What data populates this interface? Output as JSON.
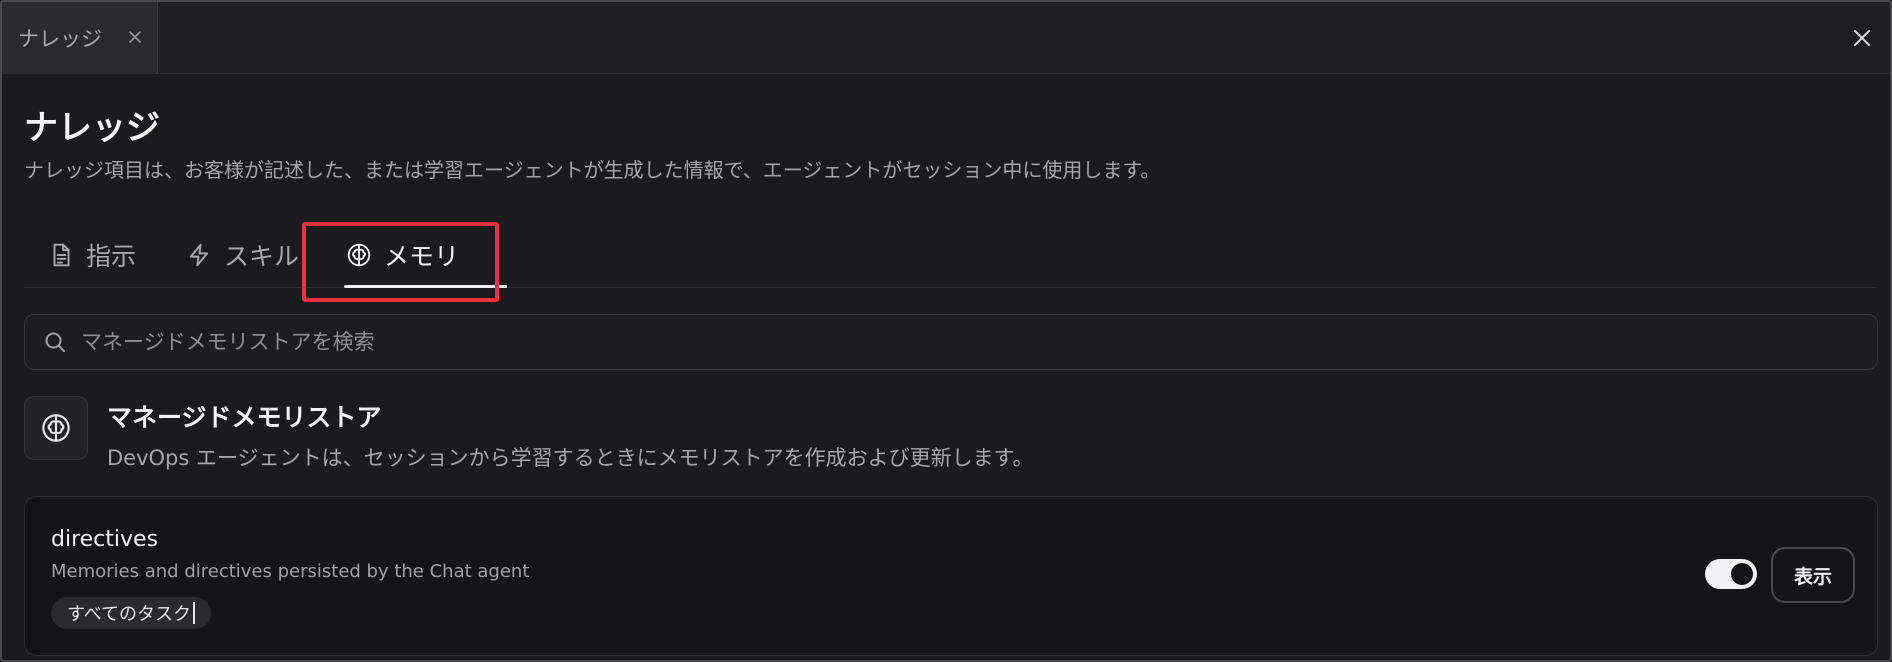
{
  "tab_strip": {
    "tab_label": "ナレッジ"
  },
  "header": {
    "title": "ナレッジ",
    "description": "ナレッジ項目は、お客様が記述した、または学習エージェントが生成した情報で、エージェントがセッション中に使用します。"
  },
  "tabs": [
    {
      "label": "指示",
      "icon": "document-icon"
    },
    {
      "label": "スキル",
      "icon": "lightning-icon"
    },
    {
      "label": "メモリ",
      "icon": "brain-icon",
      "active": true
    }
  ],
  "search": {
    "placeholder": "マネージドメモリストアを検索",
    "value": ""
  },
  "section": {
    "title": "マネージドメモリストア",
    "description": "DevOps エージェントは、セッションから学習するときにメモリストアを作成および更新します。"
  },
  "memory_store": {
    "name": "directives",
    "description": "Memories and directives persisted by the Chat agent",
    "scope": "すべてのタスク",
    "enabled": true,
    "view_button": "表示"
  },
  "colors": {
    "highlight": "#e8323f",
    "background": "#1b1b1e"
  }
}
